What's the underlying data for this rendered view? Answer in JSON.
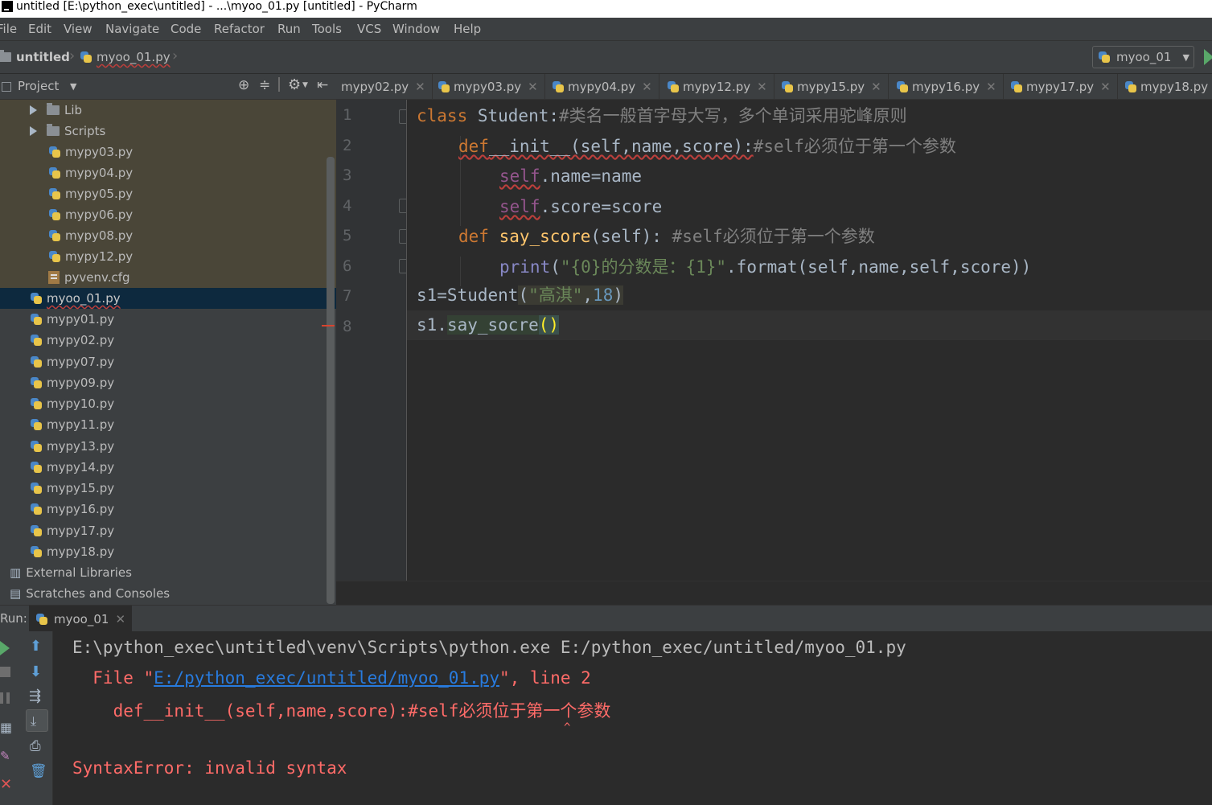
{
  "window": {
    "title": "untitled [E:\\python_exec\\untitled] - ...\\myoo_01.py [untitled] - PyCharm"
  },
  "menu": [
    "File",
    "Edit",
    "View",
    "Navigate",
    "Code",
    "Refactor",
    "Run",
    "Tools",
    "VCS",
    "Window",
    "Help"
  ],
  "navbar": {
    "project": "untitled",
    "file": "myoo_01.py",
    "run_config": "myoo_01"
  },
  "project_panel": {
    "title": "Project",
    "items": [
      {
        "label": "Lib"
      },
      {
        "label": "Scripts"
      },
      {
        "label": "mypy03.py"
      },
      {
        "label": "mypy04.py"
      },
      {
        "label": "mypy05.py"
      },
      {
        "label": "mypy06.py"
      },
      {
        "label": "mypy08.py"
      },
      {
        "label": "mypy12.py"
      },
      {
        "label": "pyvenv.cfg"
      },
      {
        "label": "myoo_01.py"
      },
      {
        "label": "mypy01.py"
      },
      {
        "label": "mypy02.py"
      },
      {
        "label": "mypy07.py"
      },
      {
        "label": "mypy09.py"
      },
      {
        "label": "mypy10.py"
      },
      {
        "label": "mypy11.py"
      },
      {
        "label": "mypy13.py"
      },
      {
        "label": "mypy14.py"
      },
      {
        "label": "mypy15.py"
      },
      {
        "label": "mypy16.py"
      },
      {
        "label": "mypy17.py"
      },
      {
        "label": "mypy18.py"
      },
      {
        "label": "External Libraries"
      },
      {
        "label": "Scratches and Consoles"
      }
    ]
  },
  "tabs": [
    "mypy02.py",
    "mypy03.py",
    "mypy04.py",
    "mypy12.py",
    "mypy15.py",
    "mypy16.py",
    "mypy17.py",
    "mypy18.py"
  ],
  "editor": {
    "line_numbers": [
      "1",
      "2",
      "3",
      "4",
      "5",
      "6",
      "7",
      "8"
    ],
    "lines": {
      "l1_kw": "class",
      "l1_name": " Student:",
      "l1_comment": "#类名一般首字母大写，多个单词采用驼峰原则",
      "l2_def": "def",
      "l2_sig": "__init__(self,name,score):",
      "l2_comment": "#self必须位于第一个参数",
      "l3_self": "self",
      "l3_rest": ".name=name",
      "l4_self": "self",
      "l4_rest": ".score=score",
      "l5_def": "def",
      "l5_fn": "say_score",
      "l5_args": "(self): ",
      "l5_comment": "#self必须位于第一个参数",
      "l6_print": "print",
      "l6_open": "(",
      "l6_str": "\"{0}的分数是：{1}\"",
      "l6_rest": ".format(self,name,self,score))",
      "l7_head": "s1=Student",
      "l7_open": "(",
      "l7_str": "\"高淇\"",
      "l7_comma": ",",
      "l7_num": "18",
      "l7_close": ")",
      "l8_head": "s1.",
      "l8_meth": "say_socre",
      "l8_paren": "()"
    }
  },
  "run_panel": {
    "label": "Run:",
    "tab": "myoo_01",
    "output": {
      "cmd": "E:\\python_exec\\untitled\\venv\\Scripts\\python.exe E:/python_exec/untitled/myoo_01.py",
      "file_pre": "  File \"",
      "file_link": "E:/python_exec/untitled/myoo_01.py",
      "file_post": "\", line 2",
      "src": "    def__init__(self,name,score):#self必须位于第一个参数",
      "caret": "^",
      "error": "SyntaxError: invalid syntax"
    }
  },
  "colors": {
    "keyword": "#cc7832",
    "comment": "#808080",
    "string": "#6a8759",
    "number": "#6897bb",
    "error": "#ff6b68",
    "link": "#287bde"
  }
}
